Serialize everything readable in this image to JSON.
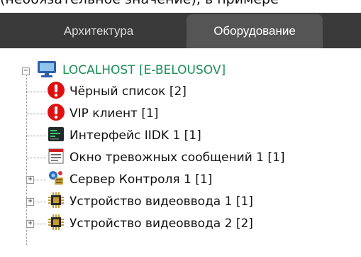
{
  "top_text": "(необязательное значение), в примере",
  "tabs": [
    {
      "label": "Архитектура",
      "active": false
    },
    {
      "label": "Оборудование",
      "active": true
    }
  ],
  "tree": {
    "root": {
      "label": "LOCALHOST [E-BELOUSOV]",
      "icon": "computer-monitor-icon",
      "expander": "−"
    },
    "items": [
      {
        "label": "Чёрный список [2]",
        "icon": "red-alert-icon",
        "expander": ""
      },
      {
        "label": "VIP клиент [1]",
        "icon": "red-alert-icon",
        "expander": ""
      },
      {
        "label": "Интерфейс IIDK 1 [1]",
        "icon": "terminal-icon",
        "expander": ""
      },
      {
        "label": "Окно тревожных сообщений 1 [1]",
        "icon": "alarm-window-icon",
        "expander": ""
      },
      {
        "label": "Сервер Контроля 1 [1]",
        "icon": "control-server-icon",
        "expander": "+"
      },
      {
        "label": "Устройство видеоввода 1 [1]",
        "icon": "chip-icon",
        "expander": "+"
      },
      {
        "label": "Устройство видеоввода 2 [2]",
        "icon": "chip-icon",
        "expander": "+"
      }
    ]
  },
  "colors": {
    "tabbar_bg": "#3a3a3a",
    "active_tab_bg": "#555555",
    "root_label": "#1a8e57",
    "alert_red": "#e01010"
  }
}
